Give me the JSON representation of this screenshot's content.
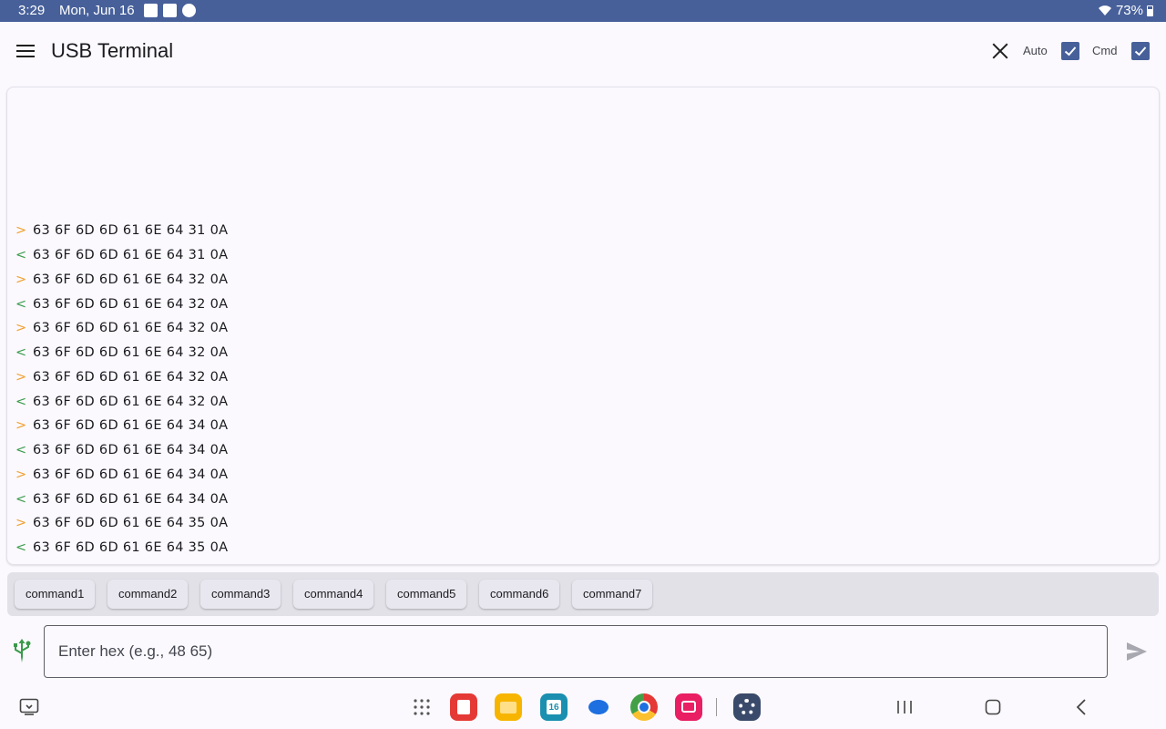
{
  "status_bar": {
    "time": "3:29",
    "date": "Mon, Jun 16",
    "battery": "73%"
  },
  "app_bar": {
    "title": "USB Terminal",
    "auto_label": "Auto",
    "auto_checked": true,
    "cmd_label": "Cmd",
    "cmd_checked": true
  },
  "log": [
    {
      "dir": ">",
      "hex": "63 6F 6D 6D 61 6E 64 31 0A"
    },
    {
      "dir": "<",
      "hex": "63 6F 6D 6D 61 6E 64 31 0A"
    },
    {
      "dir": ">",
      "hex": "63 6F 6D 6D 61 6E 64 32 0A"
    },
    {
      "dir": "<",
      "hex": "63 6F 6D 6D 61 6E 64 32 0A"
    },
    {
      "dir": ">",
      "hex": "63 6F 6D 6D 61 6E 64 32 0A"
    },
    {
      "dir": "<",
      "hex": "63 6F 6D 6D 61 6E 64 32 0A"
    },
    {
      "dir": ">",
      "hex": "63 6F 6D 6D 61 6E 64 32 0A"
    },
    {
      "dir": "<",
      "hex": "63 6F 6D 6D 61 6E 64 32 0A"
    },
    {
      "dir": ">",
      "hex": "63 6F 6D 6D 61 6E 64 34 0A"
    },
    {
      "dir": "<",
      "hex": "63 6F 6D 6D 61 6E 64 34 0A"
    },
    {
      "dir": ">",
      "hex": "63 6F 6D 6D 61 6E 64 34 0A"
    },
    {
      "dir": "<",
      "hex": "63 6F 6D 6D 61 6E 64 34 0A"
    },
    {
      "dir": ">",
      "hex": "63 6F 6D 6D 61 6E 64 35 0A"
    },
    {
      "dir": "<",
      "hex": "63 6F 6D 6D 61 6E 64 35 0A"
    }
  ],
  "commands": [
    "command1",
    "command2",
    "command3",
    "command4",
    "command5",
    "command6",
    "command7"
  ],
  "input": {
    "placeholder": "Enter hex (e.g., 48 65)",
    "value": ""
  },
  "colors": {
    "primary": "#47609a",
    "sent": "#f0a030",
    "received": "#3a9a4a",
    "usb": "#3a9a4a"
  },
  "nav_icons": [
    "taskbar-icon",
    "apps-grid-icon",
    "app-red-notes-icon",
    "app-files-folder-icon",
    "app-calendar-icon",
    "app-messages-icon",
    "app-chrome-icon",
    "app-camera-icon",
    "app-settings-icon",
    "recents-icon",
    "home-icon",
    "back-icon"
  ]
}
